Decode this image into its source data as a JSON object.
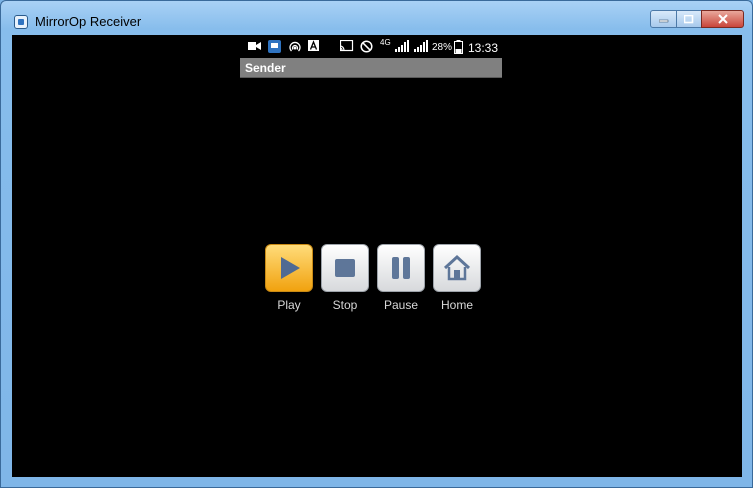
{
  "window": {
    "title": "MirrorOp Receiver",
    "controls": [
      "minimize",
      "maximize",
      "close"
    ]
  },
  "status_bar": {
    "icons": [
      "video-icon",
      "app-icon",
      "hotspot-icon",
      "a-icon",
      "cast-icon",
      "block-icon",
      "4g-icon",
      "signal-icon",
      "signal-icon",
      "battery-icon"
    ],
    "network": "4G",
    "battery": "28%",
    "time": "13:33"
  },
  "sender_bar": {
    "label": "Sender"
  },
  "controls": [
    {
      "label": "Play",
      "icon": "play-icon"
    },
    {
      "label": "Stop",
      "icon": "stop-icon"
    },
    {
      "label": "Pause",
      "icon": "pause-icon"
    },
    {
      "label": "Home",
      "icon": "home-icon"
    }
  ],
  "colors": {
    "play_accent": "#f1a20f",
    "screen_bg": "#000000"
  }
}
